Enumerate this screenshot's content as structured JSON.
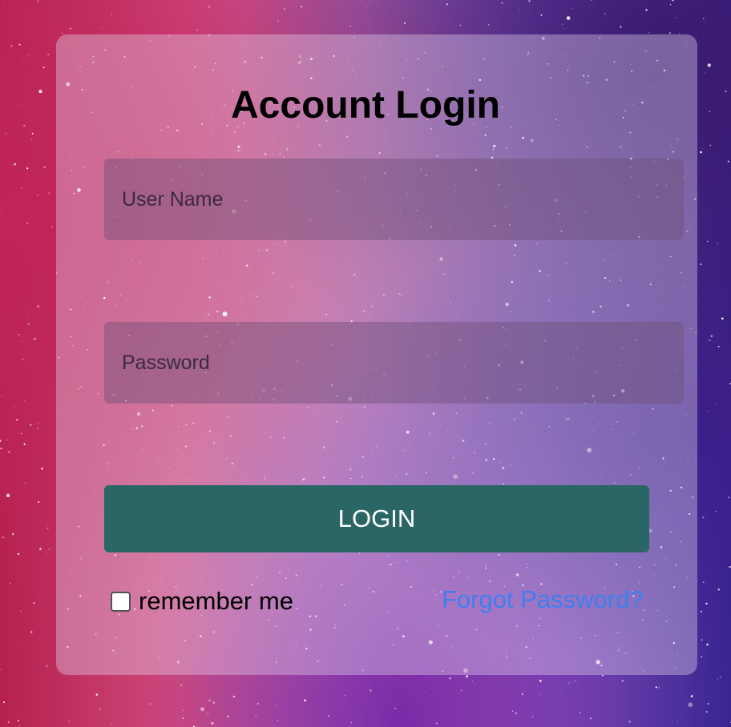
{
  "title": "Account Login",
  "form": {
    "username_placeholder": "User Name",
    "password_placeholder": "Password",
    "login_label": "LOGIN",
    "remember_label": "remember me",
    "remember_checked": false,
    "forgot_label": "Forgot Password?"
  },
  "colors": {
    "button": "#2b6666",
    "link": "#3d7ff0"
  }
}
